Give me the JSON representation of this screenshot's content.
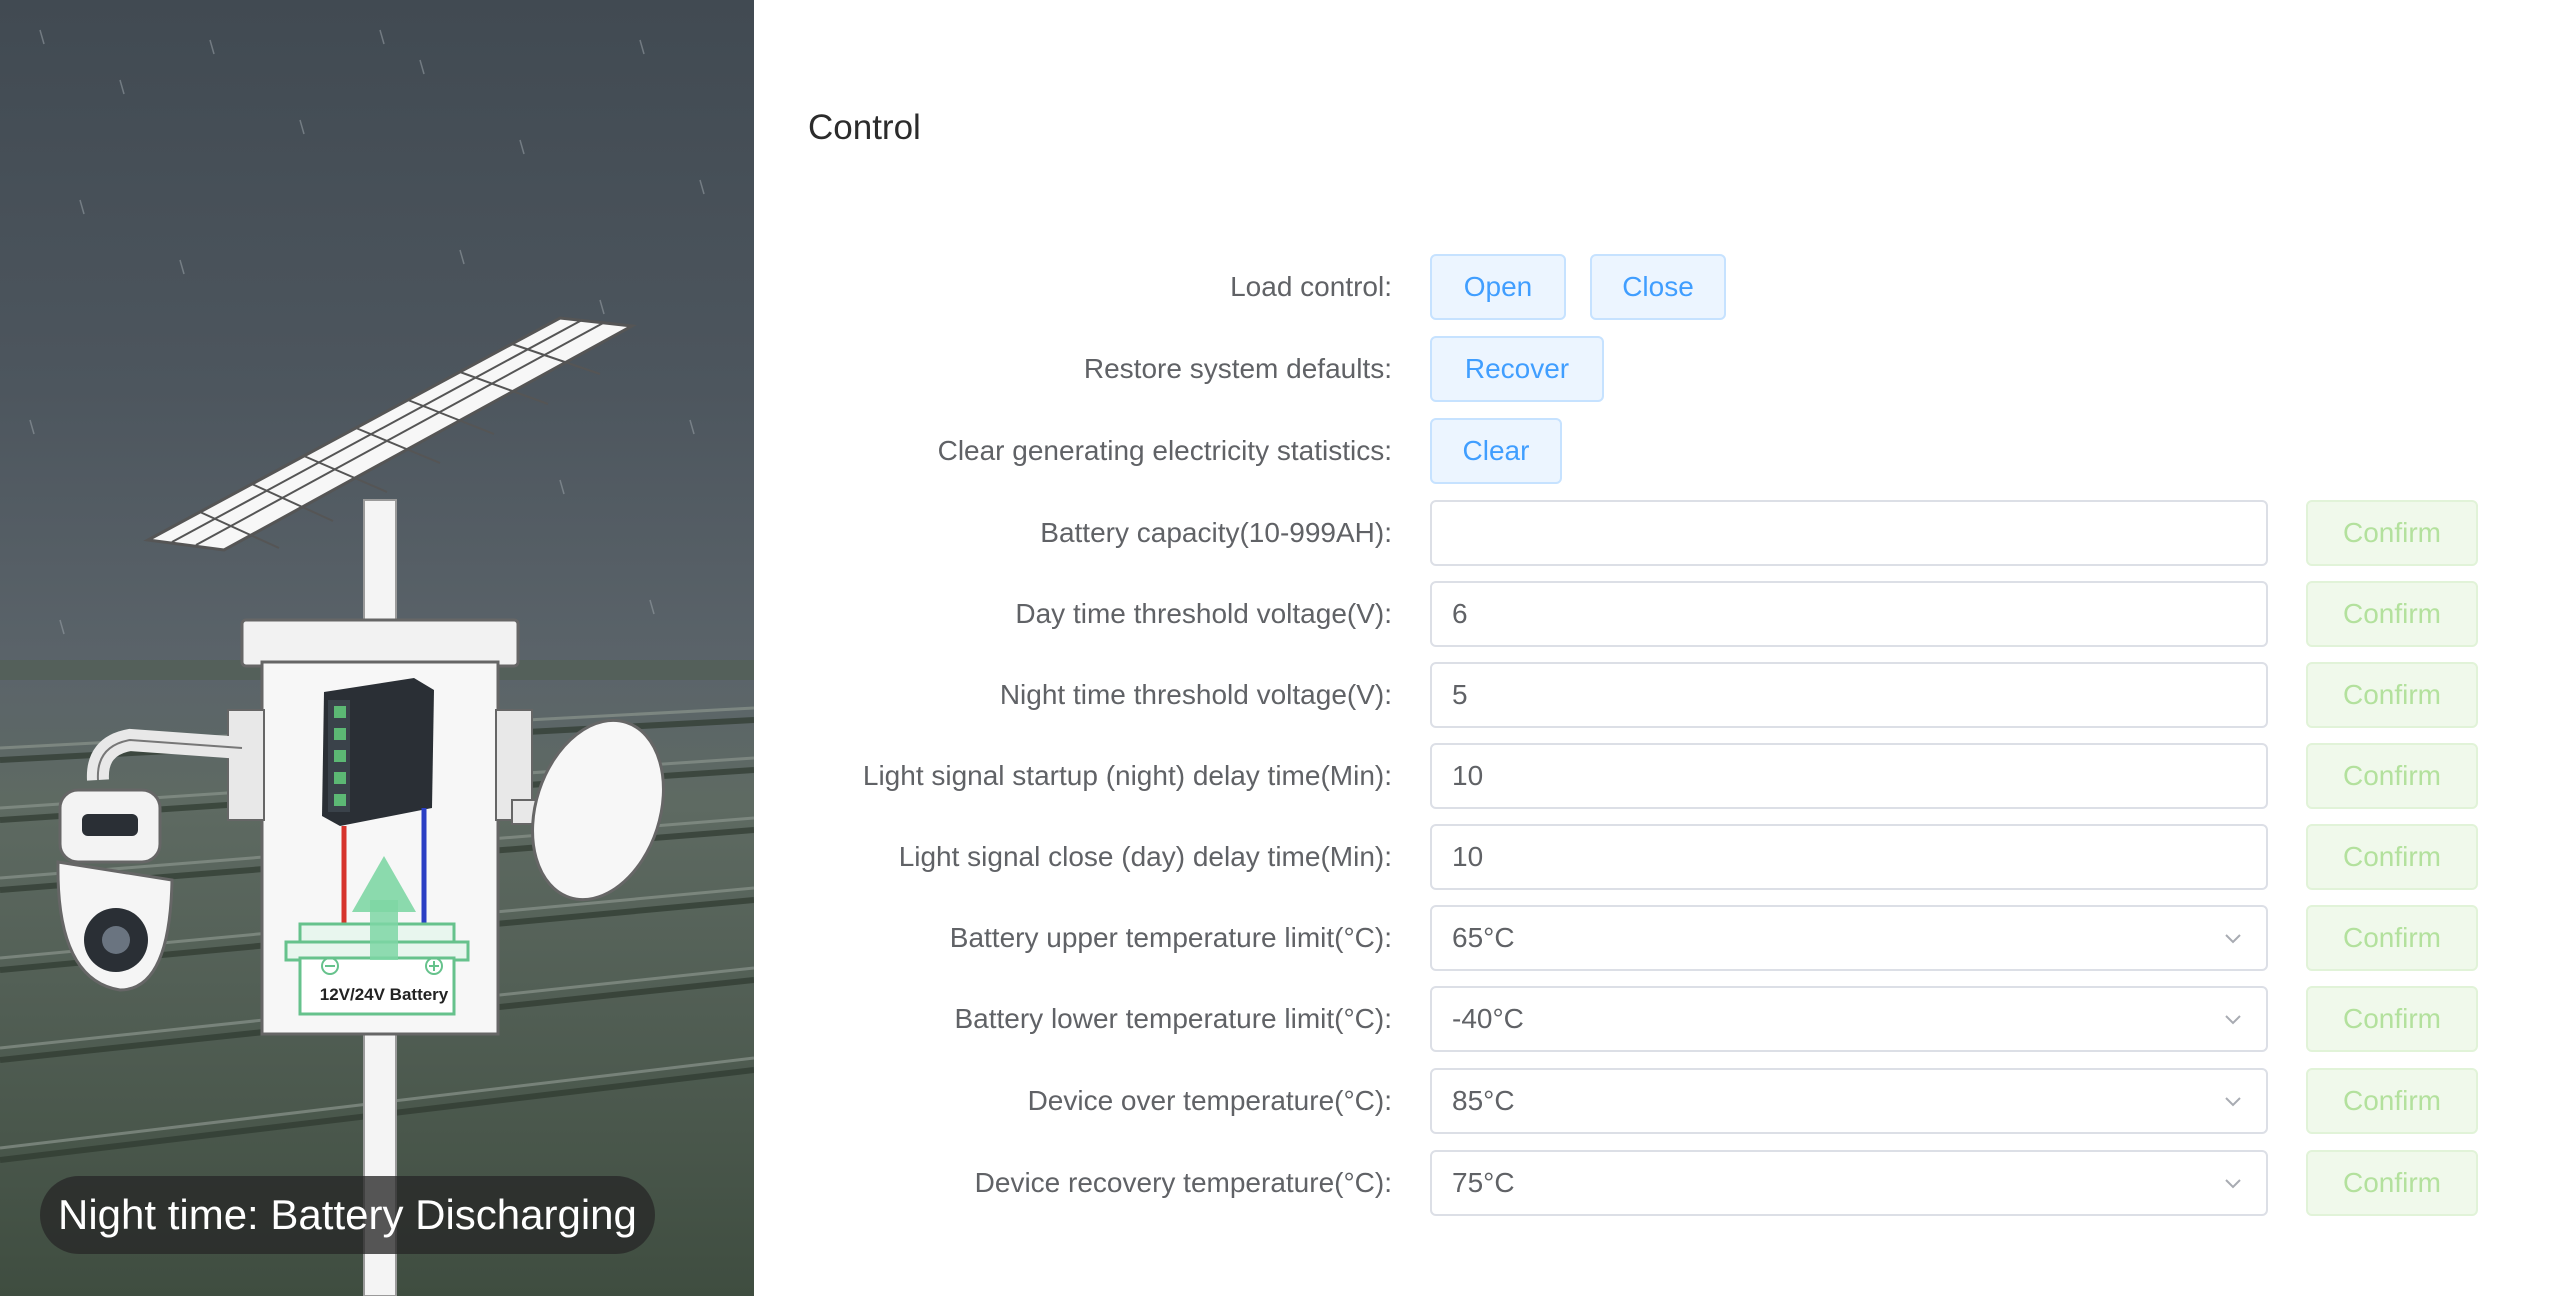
{
  "scene": {
    "caption": "Night time: Battery Discharging",
    "battery_label": "12V/24V Battery"
  },
  "control": {
    "title": "Control",
    "load_control": {
      "label": "Load control:",
      "open": "Open",
      "close": "Close"
    },
    "restore": {
      "label": "Restore system defaults:",
      "button": "Recover"
    },
    "clear_stats": {
      "label": "Clear generating electricity statistics:",
      "button": "Clear"
    },
    "fields": [
      {
        "label": "Battery capacity(10-999AH):",
        "value": "",
        "type": "input",
        "confirm": "Confirm"
      },
      {
        "label": "Day time threshold voltage(V):",
        "value": "6",
        "type": "input",
        "confirm": "Confirm"
      },
      {
        "label": "Night time threshold voltage(V):",
        "value": "5",
        "type": "input",
        "confirm": "Confirm"
      },
      {
        "label": "Light signal startup (night) delay time(Min):",
        "value": "10",
        "type": "input",
        "confirm": "Confirm"
      },
      {
        "label": "Light signal close (day) delay time(Min):",
        "value": "10",
        "type": "input",
        "confirm": "Confirm"
      },
      {
        "label": "Battery upper temperature limit(°C):",
        "value": "65°C",
        "type": "select",
        "confirm": "Confirm"
      },
      {
        "label": "Battery lower temperature limit(°C):",
        "value": "-40°C",
        "type": "select",
        "confirm": "Confirm"
      },
      {
        "label": "Device over temperature(°C):",
        "value": "85°C",
        "type": "select",
        "confirm": "Confirm"
      },
      {
        "label": "Device recovery temperature(°C):",
        "value": "75°C",
        "type": "select",
        "confirm": "Confirm"
      }
    ]
  },
  "colors": {
    "primary_button_bg": "#ecf5ff",
    "primary_button_text": "#409eff",
    "confirm_bg": "#f0f9eb",
    "confirm_text": "#b3e19d"
  },
  "icons": [
    "chevron-down-icon",
    "arrow-up-icon",
    "minus-icon",
    "plus-icon"
  ]
}
